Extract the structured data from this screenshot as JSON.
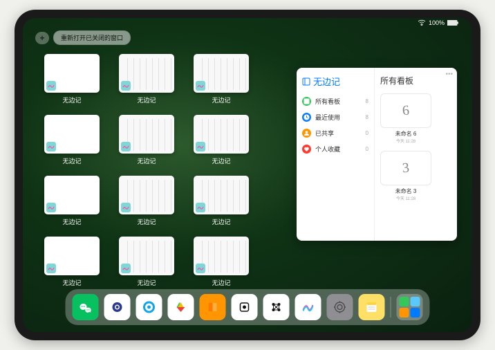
{
  "status": {
    "battery": "100%"
  },
  "topbar": {
    "plus": "+",
    "reopen_label": "重新打开已关闭的窗口"
  },
  "app_windows": [
    {
      "label": "无边记",
      "kind": "blank"
    },
    {
      "label": "无边记",
      "kind": "cal"
    },
    {
      "label": "无边记",
      "kind": "cal"
    },
    {
      "label": "无边记",
      "kind": "blank"
    },
    {
      "label": "无边记",
      "kind": "cal"
    },
    {
      "label": "无边记",
      "kind": "cal"
    },
    {
      "label": "无边记",
      "kind": "blank"
    },
    {
      "label": "无边记",
      "kind": "cal"
    },
    {
      "label": "无边记",
      "kind": "cal"
    },
    {
      "label": "无边记",
      "kind": "blank"
    },
    {
      "label": "无边记",
      "kind": "cal"
    },
    {
      "label": "无边记",
      "kind": "cal"
    }
  ],
  "panel": {
    "title": "无边记",
    "items": [
      {
        "label": "所有看板",
        "count": "8",
        "color": "#34c759",
        "icon": "square"
      },
      {
        "label": "最近使用",
        "count": "8",
        "color": "#0a7aff",
        "icon": "clock"
      },
      {
        "label": "已共享",
        "count": "0",
        "color": "#ff9500",
        "icon": "person"
      },
      {
        "label": "个人收藏",
        "count": "0",
        "color": "#ff3b30",
        "icon": "heart"
      }
    ],
    "right_title": "所有看板",
    "boards": [
      {
        "name": "未命名 6",
        "date": "今天 11:28",
        "scribble": "6"
      },
      {
        "name": "未命名 3",
        "date": "今天 11:28",
        "scribble": "3"
      }
    ]
  },
  "dock": [
    {
      "name": "wechat",
      "bg": "#07c160"
    },
    {
      "name": "browser1",
      "bg": "#ffffff"
    },
    {
      "name": "browser2",
      "bg": "#ffffff"
    },
    {
      "name": "play",
      "bg": "#ffffff"
    },
    {
      "name": "books",
      "bg": "#ff9500"
    },
    {
      "name": "dice",
      "bg": "#ffffff"
    },
    {
      "name": "graph",
      "bg": "#ffffff"
    },
    {
      "name": "freeform",
      "bg": "#ffffff"
    },
    {
      "name": "settings",
      "bg": "#8e8e93"
    },
    {
      "name": "notes",
      "bg": "#ffe066"
    },
    {
      "name": "folder",
      "bg": "rgba(255,255,255,0.25)"
    }
  ],
  "colors": {
    "accent": "#007aff"
  }
}
